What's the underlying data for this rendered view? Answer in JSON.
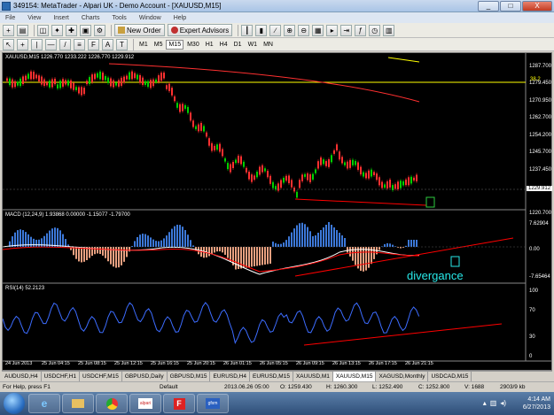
{
  "window": {
    "title": "349154: MetaTrader - Alpari UK - Demo Account - [XAUUSD,M15]",
    "min": "_",
    "max": "□",
    "close": "X"
  },
  "menu": [
    "File",
    "View",
    "Insert",
    "Charts",
    "Tools",
    "Window",
    "Help"
  ],
  "toolbar": {
    "new_order": "New Order",
    "expert_advisors": "Expert Advisors"
  },
  "timeframes": [
    "M1",
    "M5",
    "M15",
    "M30",
    "H1",
    "H4",
    "D1",
    "W1",
    "MN"
  ],
  "active_timeframe": "M15",
  "chart": {
    "header": "XAUUSD,M15  1226.770 1233.222 1226.770 1229.912",
    "price_ticks": [
      "1287.700",
      "1279.450",
      "1270.950",
      "1262.700",
      "1254.200",
      "1245.700",
      "1237.450",
      "1228.950",
      "1220.700"
    ],
    "current_price": "1229.912",
    "level_label": "38.2",
    "macd_label": "MACD (12,24,9) 1.93868 0.00000 -1.15077 -1.79700",
    "macd_ticks": [
      "7.62904",
      "0.00",
      "-7.65464"
    ],
    "rsi_label": "RSI(14) 52.2123",
    "rsi_ticks": [
      "100",
      "70",
      "30",
      "0"
    ],
    "annotation": "divergance",
    "time_labels": [
      "24 Jun 2013",
      "25 Jun 04:15",
      "25 Jun 08:15",
      "25 Jun 12:15",
      "25 Jun 16:15",
      "25 Jun 20:15",
      "26 Jun 01:15",
      "26 Jun 05:15",
      "26 Jun 09:15",
      "26 Jun 13:15",
      "26 Jun 17:15",
      "26 Jun 21:15"
    ],
    "colors": {
      "up": "#00d000",
      "down": "#ff3030",
      "macd_pos": "#3c78d8",
      "macd_neg": "#e8a080",
      "signal": "#ff0000",
      "rsi": "#3c6cff",
      "trend": "#ff0000"
    }
  },
  "tabs": [
    "AUDUSD,H4",
    "USDCHF,H1",
    "USDCHF,M15",
    "GBPUSD,Daily",
    "GBPUSD,M15",
    "EURUSD,H4",
    "EURUSD,M15",
    "XAUUSD,M1",
    "XAUUSD,M15",
    "XAGUSD,Monthly",
    "USDCAD,M15"
  ],
  "active_tab": "XAUUSD,M15",
  "status": {
    "help": "For Help, press F1",
    "profile": "Default",
    "datetime": "2013.06.26 05:00",
    "open": "O: 1259.430",
    "high": "H: 1260.300",
    "low": "L: 1252.490",
    "close": "C: 1252.800",
    "volume": "V: 1688",
    "traffic": "2903/9 kb"
  },
  "taskbar": {
    "items": [
      "ie",
      "folder",
      "chrome",
      "alpari",
      "F",
      "gfxm"
    ],
    "time": "4:14 AM",
    "date": "6/27/2013"
  }
}
